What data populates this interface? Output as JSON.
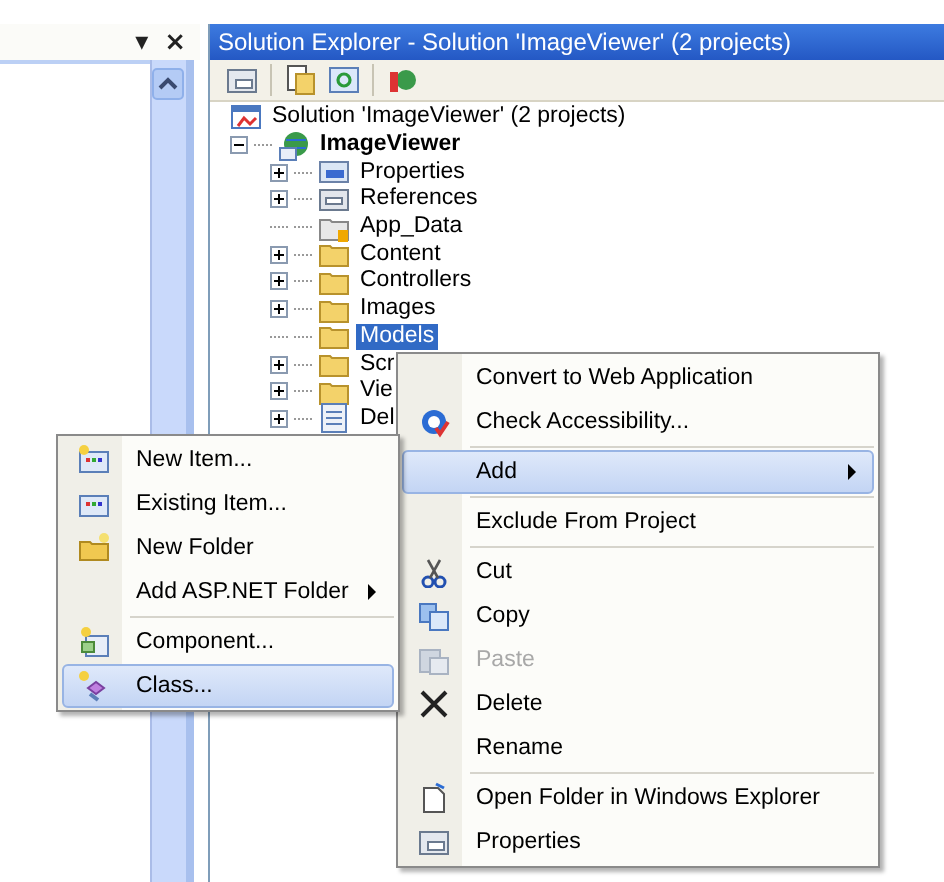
{
  "left_panel": {
    "buttons": [
      "▾",
      "×"
    ]
  },
  "solution_explorer": {
    "title": "Solution Explorer - Solution 'ImageViewer' (2 projects)",
    "tree": [
      {
        "label": "Solution 'ImageViewer' (2 projects)",
        "kind": "solution",
        "selected": false,
        "children": [
          {
            "label": "ImageViewer",
            "kind": "project",
            "expanded": true,
            "selected": false,
            "children": [
              {
                "label": "Properties",
                "kind": "properties",
                "expanded": false,
                "selected": false
              },
              {
                "label": "References",
                "kind": "references",
                "expanded": false,
                "selected": false
              },
              {
                "label": "App_Data",
                "kind": "data-folder",
                "selected": false
              },
              {
                "label": "Content",
                "kind": "folder",
                "expanded": false,
                "selected": false
              },
              {
                "label": "Controllers",
                "kind": "folder",
                "expanded": false,
                "selected": false
              },
              {
                "label": "Images",
                "kind": "folder",
                "expanded": false,
                "selected": false
              },
              {
                "label": "Models",
                "kind": "folder",
                "selected": true
              },
              {
                "label": "Scr",
                "kind": "folder",
                "expanded": false,
                "selected": false
              },
              {
                "label": "Vie",
                "kind": "folder",
                "expanded": false,
                "selected": false
              },
              {
                "label": "Del",
                "kind": "file",
                "expanded": false,
                "selected": false
              }
            ]
          }
        ]
      }
    ]
  },
  "context_menu": {
    "items": [
      {
        "kind": "plain",
        "label": "Convert to Web Application",
        "selected": false,
        "disabled": false
      },
      {
        "kind": "accessibility",
        "label": "Check Accessibility...",
        "selected": false,
        "disabled": false
      },
      {
        "kind": "separator"
      },
      {
        "kind": "plain",
        "label": "Add",
        "submenu": true,
        "selected": true,
        "disabled": false
      },
      {
        "kind": "separator"
      },
      {
        "kind": "plain",
        "label": "Exclude From Project",
        "selected": false,
        "disabled": false
      },
      {
        "kind": "separator"
      },
      {
        "kind": "cut",
        "label": "Cut",
        "selected": false,
        "disabled": false
      },
      {
        "kind": "copy",
        "label": "Copy",
        "selected": false,
        "disabled": false
      },
      {
        "kind": "paste",
        "label": "Paste",
        "selected": false,
        "disabled": true
      },
      {
        "kind": "delete",
        "label": "Delete",
        "selected": false,
        "disabled": false
      },
      {
        "kind": "plain",
        "label": "Rename",
        "selected": false,
        "disabled": false
      },
      {
        "kind": "separator"
      },
      {
        "kind": "open-folder",
        "label": "Open Folder in Windows Explorer",
        "selected": false,
        "disabled": false
      },
      {
        "kind": "properties",
        "label": "Properties",
        "selected": false,
        "disabled": false
      }
    ]
  },
  "submenu": {
    "items": [
      {
        "kind": "new-item",
        "label": "New Item...",
        "selected": false,
        "disabled": false
      },
      {
        "kind": "existing-item",
        "label": "Existing Item...",
        "selected": false,
        "disabled": false
      },
      {
        "kind": "new-folder",
        "label": "New Folder",
        "selected": false,
        "disabled": false
      },
      {
        "kind": "plain",
        "label": "Add ASP.NET Folder",
        "submenu": true,
        "selected": false,
        "disabled": false
      },
      {
        "kind": "separator"
      },
      {
        "kind": "component",
        "label": "Component...",
        "selected": false,
        "disabled": false
      },
      {
        "kind": "class",
        "label": "Class...",
        "selected": true,
        "disabled": false
      }
    ]
  }
}
